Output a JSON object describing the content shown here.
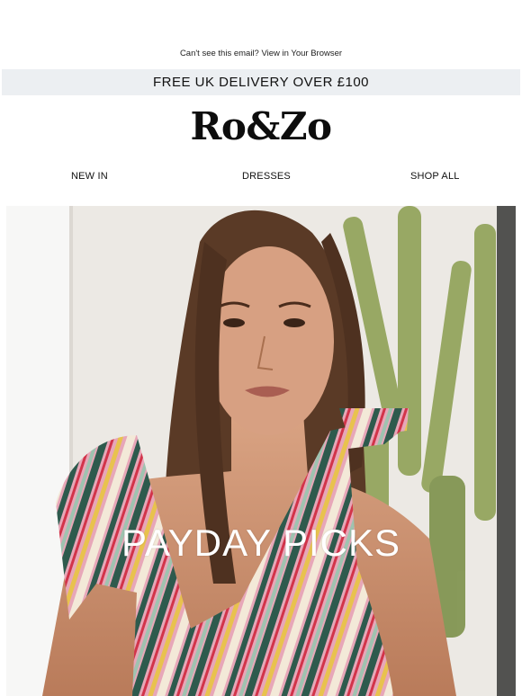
{
  "preheader": {
    "text": "Can't see this email? View in Your Browser"
  },
  "banner": {
    "text": "FREE UK DELIVERY OVER £100"
  },
  "brand": {
    "logo": "Ro&Zo"
  },
  "nav": {
    "items": [
      {
        "label": "NEW IN"
      },
      {
        "label": "DRESSES"
      },
      {
        "label": "SHOP ALL"
      }
    ]
  },
  "hero": {
    "title": "PAYDAY PICKS",
    "image": "model-in-striped-halter-dress"
  },
  "colors": {
    "banner_bg": "#eceff2",
    "hero_text": "#ffffff",
    "stripe_pink": "#e7a7b8",
    "stripe_green": "#2e5a4d",
    "stripe_red": "#d2344a",
    "stripe_yellow": "#e8c24e",
    "cactus": "#8fa157"
  }
}
